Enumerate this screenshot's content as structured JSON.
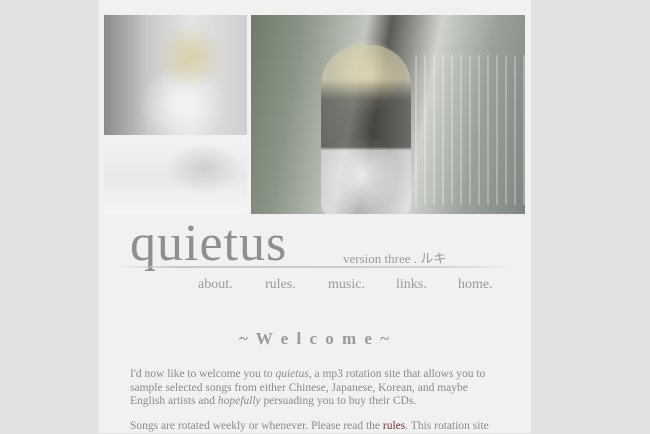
{
  "site": {
    "logo": "quietus",
    "version": "version three . ルキ"
  },
  "nav": {
    "items": [
      "about.",
      "rules.",
      "music.",
      "links.",
      "home."
    ]
  },
  "welcome": {
    "heading": "~ W e l c o m e ~"
  },
  "intro": {
    "p1_a": "I'd now like to welcome you to ",
    "p1_em1": "quietus",
    "p1_b": ", a mp3 rotation site that allows you to sample selected songs from either Chinese, Japanese, Korean, and maybe English artists and ",
    "p1_em2": "hopefully",
    "p1_c": " persuading you to buy their CDs.",
    "p2_a": "Songs are rotated weekly or whenever. Please read the ",
    "p2_link": "rules",
    "p2_b": ". This rotation site"
  },
  "colors": {
    "background": "#e2e2e2",
    "page": "#f1f1f1",
    "text": "#8a8a8a",
    "link": "#7a2d2d"
  }
}
